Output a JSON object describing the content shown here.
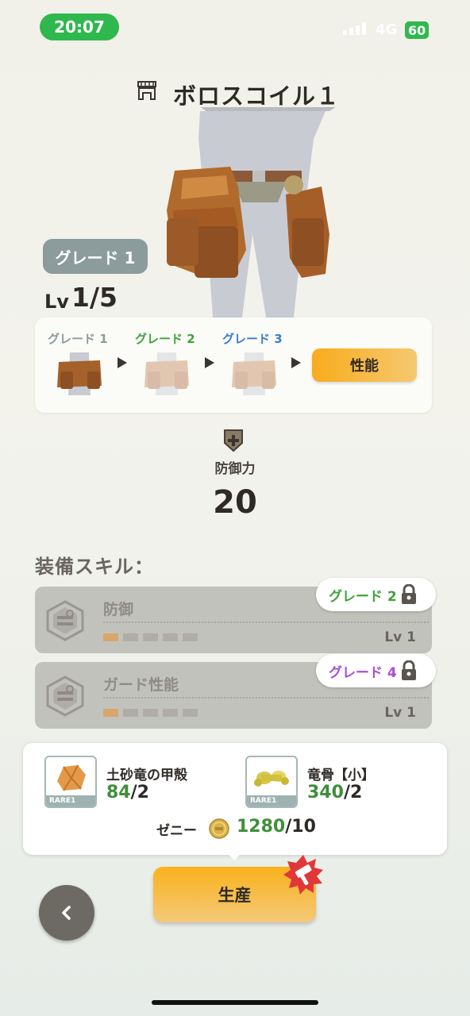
{
  "status_bar": {
    "time": "20:07",
    "network": "4G",
    "battery": "60"
  },
  "header": {
    "title": "ボロスコイル１",
    "icon": "waist-armor-icon"
  },
  "item": {
    "grade_badge": "グレード 1",
    "lv_label": "Lv",
    "lv_value": "1/5"
  },
  "grades": {
    "items": [
      {
        "label": "グレード 1",
        "color": "#8c9c9c"
      },
      {
        "label": "グレード 2",
        "color": "#3fa33a"
      },
      {
        "label": "グレード 3",
        "color": "#3a7fd0"
      }
    ],
    "perf_button": "性能"
  },
  "defense": {
    "label": "防御力",
    "value": "20"
  },
  "skills": {
    "heading": "装備スキル：",
    "items": [
      {
        "name": "防御",
        "lock_label": "グレード 2",
        "lock_color": "#3fa33a",
        "level": "Lv 1",
        "pips_total": 5,
        "pips_filled": 1
      },
      {
        "name": "ガード性能",
        "lock_label": "グレード 4",
        "lock_color": "#a84fd6",
        "level": "Lv 1",
        "pips_total": 5,
        "pips_filled": 1
      }
    ]
  },
  "materials": {
    "items": [
      {
        "name": "土砂竜の甲殻",
        "have": "84",
        "need": "/2",
        "rarity": "RARE1"
      },
      {
        "name": "竜骨【小】",
        "have": "340",
        "need": "/2",
        "rarity": "RARE1"
      }
    ],
    "zeny": {
      "label": "ゼニー",
      "have": "1280",
      "need": "/10"
    }
  },
  "actions": {
    "produce": "生産",
    "back": "back-chevron-icon"
  }
}
